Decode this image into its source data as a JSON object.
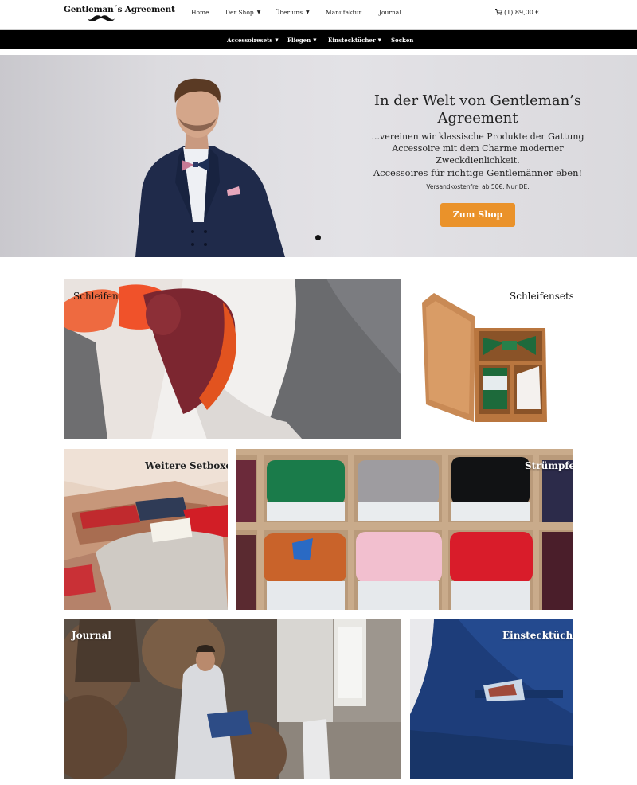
{
  "header": {
    "logo_text": "Gentleman´s Agreement",
    "nav": [
      {
        "label": "Home",
        "has_dropdown": false
      },
      {
        "label": "Der Shop",
        "has_dropdown": true
      },
      {
        "label": "Über uns",
        "has_dropdown": true
      },
      {
        "label": "Manufaktur",
        "has_dropdown": false
      },
      {
        "label": "Journal",
        "has_dropdown": false
      }
    ],
    "cart": {
      "count_label": "(1)",
      "total": "89,00 €"
    }
  },
  "subnav": {
    "items": [
      {
        "label": "Accessoiresets",
        "has_dropdown": true
      },
      {
        "label": "Fliegen",
        "has_dropdown": true
      },
      {
        "label": "Einstecktücher",
        "has_dropdown": true
      },
      {
        "label": "Socken",
        "has_dropdown": false
      }
    ]
  },
  "hero": {
    "title": "In der Welt von Gentleman’s Agreement",
    "subtitle": "...vereinen wir klassische Produkte der Gattung Accessoire mit dem Charme moderner Zweckdienlichkeit.",
    "tagline": "Accessoires für richtige Gentlemänner eben!",
    "shipping": "Versandkostenfrei ab 50€. Nur DE.",
    "button": "Zum Shop"
  },
  "tiles": [
    {
      "label": "Schleifen"
    },
    {
      "label": "Schleifensets"
    },
    {
      "label": "Weitere Setboxen"
    },
    {
      "label": "Strümpfe"
    },
    {
      "label": "Journal"
    },
    {
      "label": "Einstecktücher"
    }
  ],
  "colors": {
    "accent_button": "#ea922a",
    "subnav_bg": "#000000",
    "hero_bg": "#dedde1"
  }
}
